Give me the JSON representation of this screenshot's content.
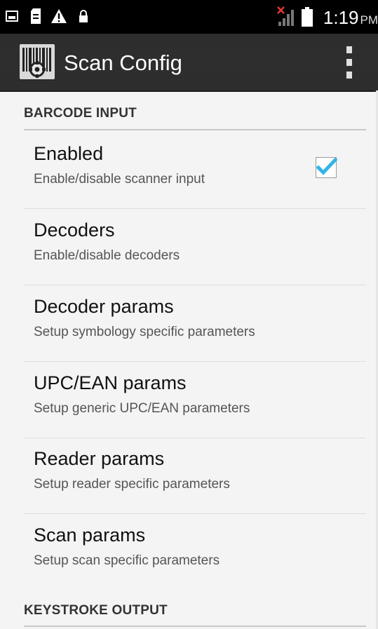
{
  "status_bar": {
    "time": "1:19",
    "ampm": "PM",
    "icons": [
      "screenshot-icon",
      "sd-card-icon",
      "warning-icon",
      "lock-icon",
      "no-signal-icon",
      "battery-icon"
    ]
  },
  "action_bar": {
    "title": "Scan Config",
    "app_icon": "barcode-gear-icon",
    "overflow_icon": "overflow-menu-icon"
  },
  "sections": [
    {
      "header": "BARCODE INPUT",
      "items": [
        {
          "title": "Enabled",
          "summary": "Enable/disable scanner input",
          "checkbox": true,
          "checked": true
        },
        {
          "title": "Decoders",
          "summary": "Enable/disable decoders"
        },
        {
          "title": "Decoder params",
          "summary": "Setup symbology specific parameters"
        },
        {
          "title": "UPC/EAN params",
          "summary": "Setup generic UPC/EAN parameters"
        },
        {
          "title": "Reader params",
          "summary": "Setup reader specific parameters"
        },
        {
          "title": "Scan params",
          "summary": "Setup scan specific parameters"
        }
      ]
    },
    {
      "header": "KEYSTROKE OUTPUT",
      "items": []
    }
  ],
  "colors": {
    "status_bar": "#000000",
    "action_bar": "#2c2c2c",
    "background": "#f4f4f4",
    "check_accent": "#33b5e5"
  }
}
